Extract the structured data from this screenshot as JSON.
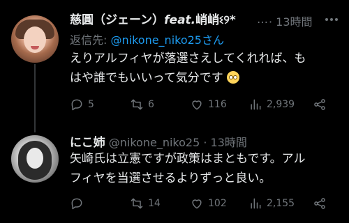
{
  "tweets": [
    {
      "name": "慈圓（ジェーン）",
      "name_suffix": "feat.",
      "name_tail": "峭峭ଽ୨*",
      "ellipsis": "…",
      "time": "13時間",
      "reply_prefix": "返信先:",
      "reply_mention": "@nikone_niko25さん",
      "text_line1": "えりアルフィヤが落選さえしてくれれば、も",
      "text_line2": "はや誰でもいいって気分です",
      "actions": {
        "reply": "5",
        "retweet": "6",
        "like": "116",
        "views": "2,939"
      }
    },
    {
      "name": "にこ姉",
      "handle": "@nikone_niko25",
      "time": "13時間",
      "text_line1": "矢崎氏は立憲ですが政策はまともです。アル",
      "text_line2": "フィヤを当選させるよりずっと良い。",
      "actions": {
        "reply": "",
        "retweet": "14",
        "like": "102",
        "views": "2,155"
      }
    }
  ],
  "icons": [
    "reply-icon",
    "retweet-icon",
    "like-icon",
    "views-icon",
    "share-icon"
  ]
}
